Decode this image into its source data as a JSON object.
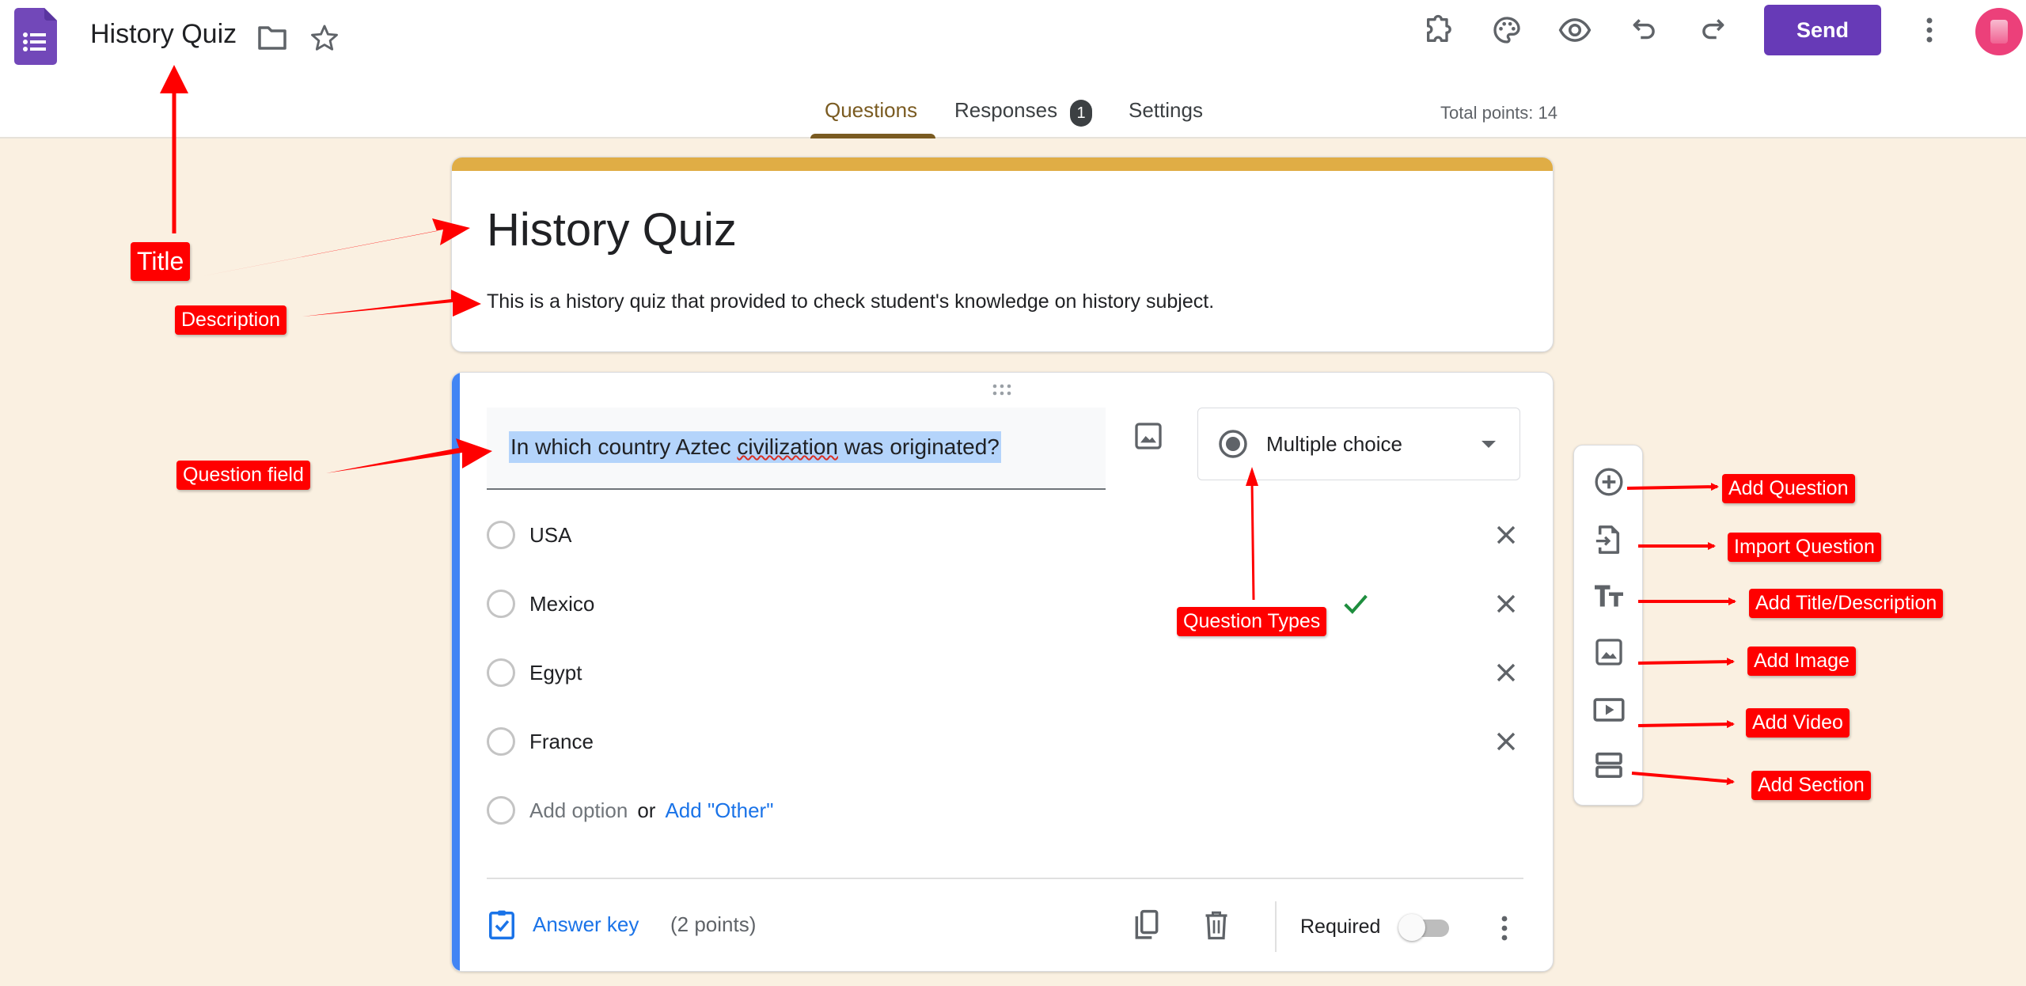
{
  "header": {
    "app_icon": "google-forms-icon",
    "doc_title": "History Quiz",
    "icons": [
      "folder-icon",
      "star-icon",
      "addons-icon",
      "palette-icon",
      "preview-eye-icon",
      "undo-icon",
      "redo-icon",
      "more-vert-icon"
    ],
    "send_label": "Send",
    "avatar_icon": "account-avatar"
  },
  "tabs": {
    "items": [
      {
        "label": "Questions",
        "active": true
      },
      {
        "label": "Responses",
        "badge": "1",
        "active": false
      },
      {
        "label": "Settings",
        "active": false
      }
    ],
    "total_points": "Total points: 14"
  },
  "form": {
    "title": "History Quiz",
    "description": "This is a history quiz that provided to check student's knowledge on history subject.",
    "accent_color": "#e0ad45",
    "background_color": "#faf0e1"
  },
  "question": {
    "text_before": "In which country Aztec ",
    "text_misspelled": "civilization",
    "text_after": " was originated?",
    "type": "Multiple choice",
    "options": [
      {
        "label": "USA",
        "correct": false
      },
      {
        "label": "Mexico",
        "correct": true
      },
      {
        "label": "Egypt",
        "correct": false
      },
      {
        "label": "France",
        "correct": false
      }
    ],
    "add_option_label": "Add option",
    "or_label": "or",
    "add_other_label": "Add \"Other\"",
    "answer_key_label": "Answer key",
    "points_label": "(2 points)",
    "required_label": "Required",
    "required": false,
    "accent_color": "#4285f4"
  },
  "side_toolbar": {
    "items": [
      {
        "icon": "add-circle-icon",
        "tooltip": "Add question"
      },
      {
        "icon": "import-icon",
        "tooltip": "Import questions"
      },
      {
        "icon": "title-text-icon",
        "tooltip": "Add title and description"
      },
      {
        "icon": "image-icon",
        "tooltip": "Add image"
      },
      {
        "icon": "video-icon",
        "tooltip": "Add video"
      },
      {
        "icon": "section-icon",
        "tooltip": "Add section"
      }
    ]
  },
  "annotations": {
    "title": "Title",
    "description": "Description",
    "question_field": "Question field",
    "question_types": "Question Types",
    "add_question": "Add Question",
    "import_question": "Import Question",
    "add_title_description": "Add Title/Description",
    "add_image": "Add Image",
    "add_video": "Add Video",
    "add_section": "Add Section"
  }
}
